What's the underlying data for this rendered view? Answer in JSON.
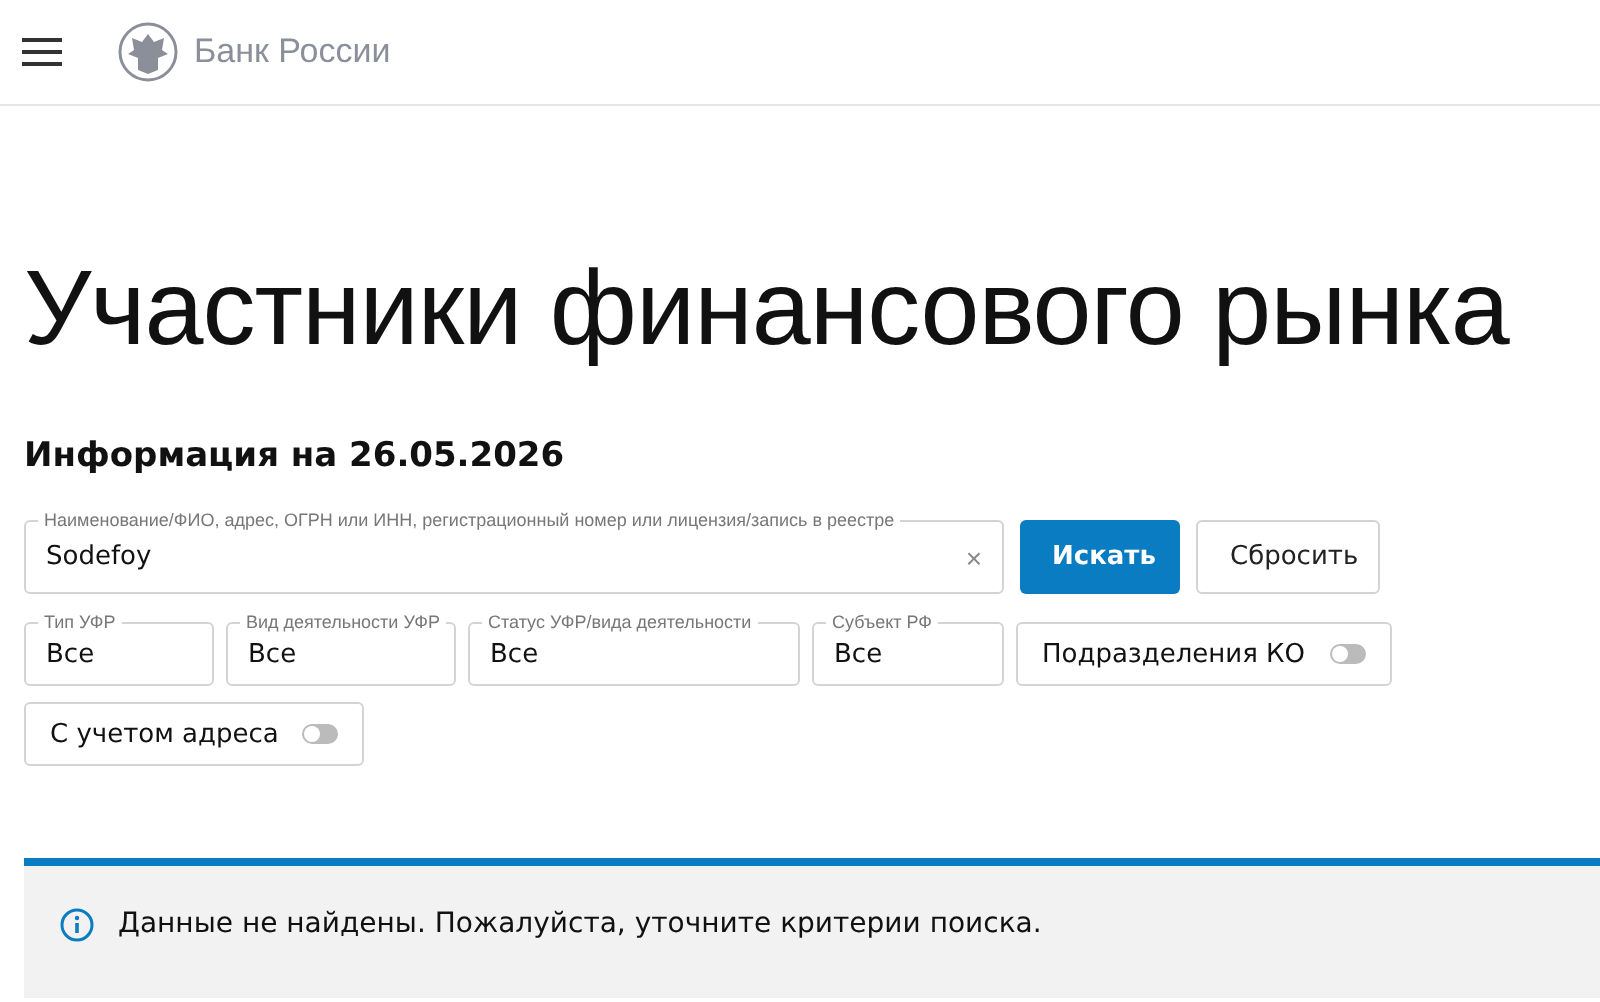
{
  "header": {
    "logo_text": "Банк России"
  },
  "title": "Участники финансового рынка",
  "info_date": "Информация на 26.05.2026",
  "search": {
    "label": "Наименование/ФИО, адрес, ОГРН или ИНН, регистрационный номер или лицензия/запись в реестре",
    "value": "Sodefoy",
    "clear": "×"
  },
  "buttons": [
    {
      "kind": "primary",
      "label": "Искать"
    },
    {
      "kind": "secondary",
      "label": "Сбросить"
    }
  ],
  "filters": [
    {
      "kind": "select",
      "label": "Тип УФР",
      "value": "Все"
    },
    {
      "kind": "select",
      "label": "Вид деятельности УФР",
      "value": "Все"
    },
    {
      "kind": "select",
      "label": "Статус УФР/вида деятельности",
      "value": "Все"
    },
    {
      "kind": "select",
      "label": "Субъект РФ",
      "value": "Все"
    },
    {
      "kind": "toggle",
      "label": "Подразделения КО",
      "on": false
    },
    {
      "kind": "toggle",
      "label": "С учетом адреса",
      "on": false
    }
  ],
  "alert": {
    "message": "Данные не найдены. Пожалуйста, уточните критерии поиска."
  }
}
